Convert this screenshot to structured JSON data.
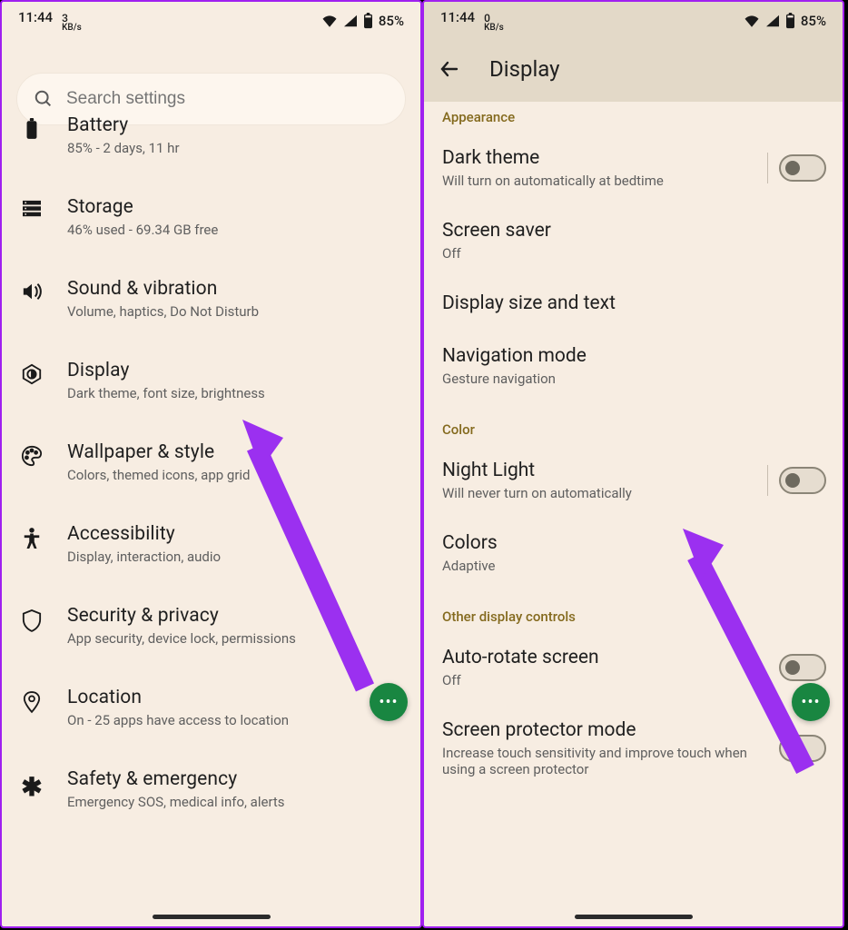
{
  "status": {
    "time": "11:44",
    "kbs_left": "3",
    "kbs_unit": "KB/s",
    "kbs_right": "0",
    "battery_pct": "85%"
  },
  "left_screen": {
    "search_placeholder": "Search settings",
    "items": [
      {
        "key": "battery",
        "title": "Battery",
        "sub": "85% - 2 days, 11 hr"
      },
      {
        "key": "storage",
        "title": "Storage",
        "sub": "46% used - 69.34 GB free"
      },
      {
        "key": "sound",
        "title": "Sound & vibration",
        "sub": "Volume, haptics, Do Not Disturb"
      },
      {
        "key": "display",
        "title": "Display",
        "sub": "Dark theme, font size, brightness"
      },
      {
        "key": "wallpaper",
        "title": "Wallpaper & style",
        "sub": "Colors, themed icons, app grid"
      },
      {
        "key": "accessibility",
        "title": "Accessibility",
        "sub": "Display, interaction, audio"
      },
      {
        "key": "security",
        "title": "Security & privacy",
        "sub": "App security, device lock, permissions"
      },
      {
        "key": "location",
        "title": "Location",
        "sub": "On - 25 apps have access to location"
      },
      {
        "key": "safety",
        "title": "Safety & emergency",
        "sub": "Emergency SOS, medical info, alerts"
      }
    ]
  },
  "right_screen": {
    "app_title": "Display",
    "sections": {
      "appearance": {
        "label": "Appearance",
        "items": [
          {
            "title": "Dark theme",
            "sub": "Will turn on automatically at bedtime",
            "toggle": "off",
            "sep": true
          },
          {
            "title": "Screen saver",
            "sub": "Off"
          },
          {
            "title": "Display size and text",
            "sub": ""
          },
          {
            "title": "Navigation mode",
            "sub": "Gesture navigation"
          }
        ]
      },
      "color": {
        "label": "Color",
        "items": [
          {
            "title": "Night Light",
            "sub": "Will never turn on automatically",
            "toggle": "off",
            "sep": true
          },
          {
            "title": "Colors",
            "sub": "Adaptive"
          }
        ]
      },
      "other": {
        "label": "Other display controls",
        "items": [
          {
            "title": "Auto-rotate screen",
            "sub": "Off",
            "toggle": "off"
          },
          {
            "title": "Screen protector mode",
            "sub": "Increase touch sensitivity and improve touch when using a screen protector",
            "toggle": "off"
          }
        ]
      }
    }
  }
}
